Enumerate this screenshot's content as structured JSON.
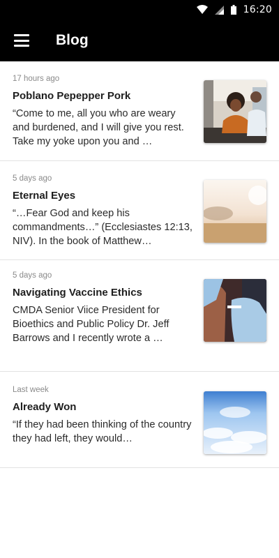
{
  "status_bar": {
    "time": "16:20",
    "icons": [
      "wifi-icon",
      "signal-icon",
      "battery-icon"
    ]
  },
  "app_bar": {
    "menu_icon": "hamburger-menu-icon",
    "title": "Blog"
  },
  "posts": [
    {
      "time": "17 hours ago",
      "title": "Poblano Pepepper Pork",
      "excerpt": "“Come to me, all you who are weary and burdened, and I will give you rest. Take my yoke upon you and …",
      "thumbnail": "kitchen-family-photo"
    },
    {
      "time": "5 days ago",
      "title": "Eternal Eyes",
      "excerpt": "“…Fear God and keep his commandments…” (Ecclesiastes 12:13, NIV). In the book of Matthew…",
      "thumbnail": "sunlit-meadow-photo"
    },
    {
      "time": "5 days ago",
      "title": "Navigating Vaccine Ethics",
      "excerpt": "CMDA Senior Viice President for Bioethics and Public Policy Dr. Jeff Barrows and I recently wrote a …",
      "thumbnail": "vaccine-injection-photo"
    },
    {
      "time": "Last week",
      "title": "Already Won",
      "excerpt": "“If they had been thinking of the country they had left, they would…",
      "thumbnail": "clouds-sky-photo"
    }
  ]
}
